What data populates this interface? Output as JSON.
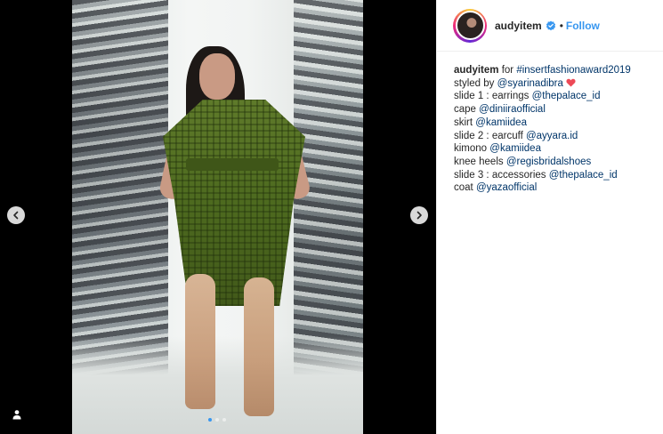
{
  "post": {
    "username": "audyitem",
    "separator": "•",
    "follow_label": "Follow",
    "caption": [
      {
        "parts": [
          {
            "t": "audyitem",
            "k": "bold"
          },
          {
            "t": " for ",
            "k": "text"
          },
          {
            "t": "#insertfashionaward2019",
            "k": "link"
          }
        ]
      },
      {
        "parts": [
          {
            "t": "styled by ",
            "k": "text"
          },
          {
            "t": "@syarinadibra",
            "k": "link"
          }
        ],
        "heart": true
      },
      {
        "parts": [
          {
            "t": "slide 1 : earrings ",
            "k": "text"
          },
          {
            "t": "@thepalace_id",
            "k": "link"
          }
        ]
      },
      {
        "parts": [
          {
            "t": "cape ",
            "k": "text"
          },
          {
            "t": "@diniiraofficial",
            "k": "link"
          }
        ]
      },
      {
        "parts": [
          {
            "t": "skirt ",
            "k": "text"
          },
          {
            "t": "@kamiidea",
            "k": "link"
          }
        ]
      },
      {
        "parts": [
          {
            "t": "slide 2 : earcuff ",
            "k": "text"
          },
          {
            "t": "@ayyara.id",
            "k": "link"
          }
        ]
      },
      {
        "parts": [
          {
            "t": "kimono ",
            "k": "text"
          },
          {
            "t": "@kamiidea",
            "k": "link"
          }
        ]
      },
      {
        "parts": [
          {
            "t": "knee heels ",
            "k": "text"
          },
          {
            "t": "@regisbridalshoes",
            "k": "link"
          }
        ]
      },
      {
        "parts": [
          {
            "t": "slide 3 : accessories ",
            "k": "text"
          },
          {
            "t": "@thepalace_id",
            "k": "link"
          }
        ]
      },
      {
        "parts": [
          {
            "t": "coat ",
            "k": "text"
          },
          {
            "t": "@yazaofficial",
            "k": "link"
          }
        ]
      }
    ]
  },
  "carousel": {
    "slide_count": 3,
    "active_slide": 1
  },
  "icons": {
    "prev": "chevron-left-icon",
    "next": "chevron-right-icon",
    "verified": "verified-badge-icon",
    "heart": "red-heart-icon",
    "tag": "user-tag-icon"
  },
  "colors": {
    "link": "#003569",
    "follow": "#3897f0",
    "verified": "#3897f0",
    "heart": "#ed4956",
    "media_bg": "#000000"
  }
}
